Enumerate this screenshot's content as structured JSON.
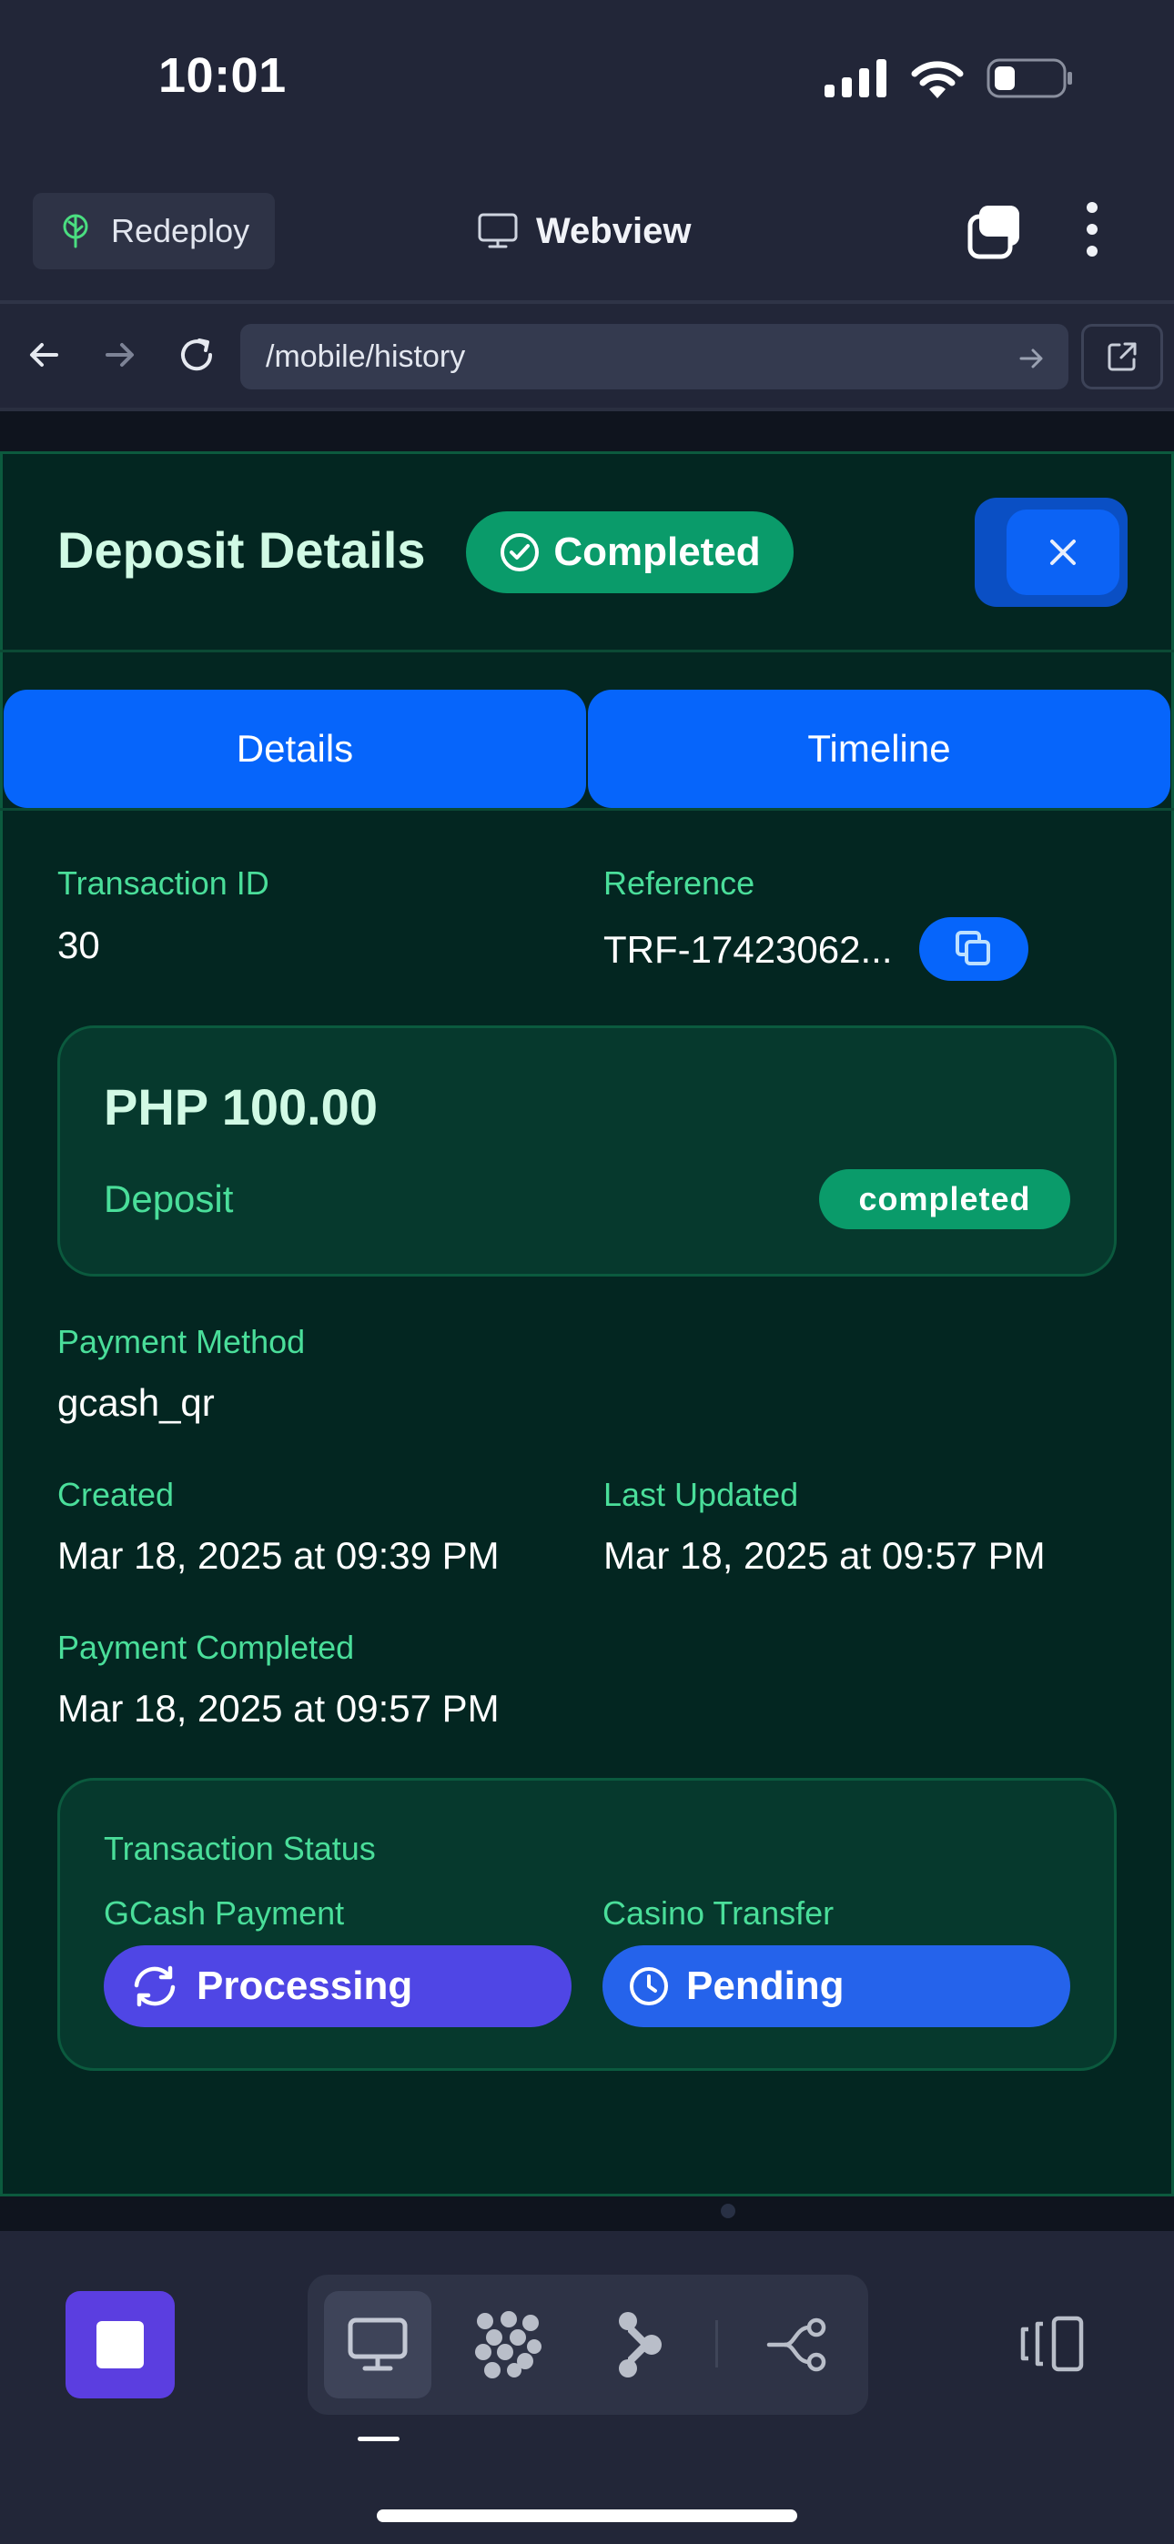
{
  "status_bar": {
    "time": "10:01",
    "icons": [
      "signal-icon",
      "wifi-icon",
      "battery-icon"
    ]
  },
  "topbar": {
    "redeploy_label": "Redeploy",
    "title": "Webview",
    "icons": [
      "tree-icon",
      "monitor-icon",
      "tabs-icon",
      "kebab-menu-icon"
    ]
  },
  "urlbar": {
    "url": "/mobile/history",
    "icons": [
      "back-arrow-icon",
      "forward-arrow-icon",
      "reload-icon",
      "go-arrow-icon",
      "open-external-icon"
    ]
  },
  "modal": {
    "title": "Deposit Details",
    "status_badge": "Completed",
    "tabs": [
      {
        "label": "Details"
      },
      {
        "label": "Timeline"
      }
    ],
    "transaction_id": {
      "label": "Transaction ID",
      "value": "30"
    },
    "reference": {
      "label": "Reference",
      "value": "TRF-17423062..."
    },
    "amount_card": {
      "amount": "PHP 100.00",
      "type": "Deposit",
      "status": "completed"
    },
    "payment_method": {
      "label": "Payment Method",
      "value": "gcash_qr"
    },
    "created": {
      "label": "Created",
      "value": "Mar 18, 2025 at 09:39 PM"
    },
    "last_updated": {
      "label": "Last Updated",
      "value": "Mar 18, 2025 at 09:57 PM"
    },
    "payment_completed": {
      "label": "Payment Completed",
      "value": "Mar 18, 2025 at 09:57 PM"
    },
    "status_card": {
      "title": "Transaction Status",
      "gcash": {
        "label": "GCash Payment",
        "status": "Processing"
      },
      "casino": {
        "label": "Casino Transfer",
        "status": "Pending"
      }
    }
  },
  "toolbar": {
    "icons": [
      "stop-icon",
      "webview-monitor-icon",
      "grid-dots-icon",
      "workflow-icon",
      "git-branch-icon",
      "device-rotate-icon"
    ]
  },
  "colors": {
    "accent_blue": "#0665fb",
    "success_green": "#0a9b6a",
    "label_green": "#4ade9a",
    "modal_bg": "#032621",
    "processing_purple": "#4f46e5",
    "pending_blue": "#2563eb"
  }
}
